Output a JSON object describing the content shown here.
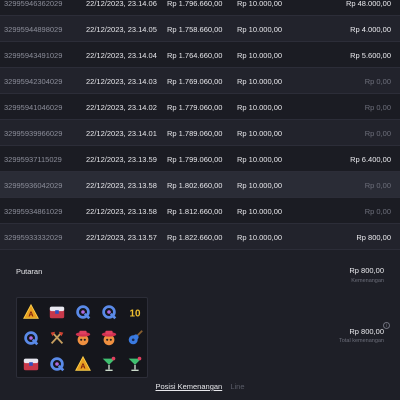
{
  "rows": [
    {
      "id": "32995946362029",
      "date": "22/12/2023, 23.14.06",
      "saldo": "Rp 1.796.660,00",
      "bet": "Rp 10.000,00",
      "win": "Rp 48.000,00",
      "zero": false
    },
    {
      "id": "32995944898029",
      "date": "22/12/2023, 23.14.05",
      "saldo": "Rp 1.758.660,00",
      "bet": "Rp 10.000,00",
      "win": "Rp 4.000,00",
      "zero": false
    },
    {
      "id": "32995943491029",
      "date": "22/12/2023, 23.14.04",
      "saldo": "Rp 1.764.660,00",
      "bet": "Rp 10.000,00",
      "win": "Rp 5.600,00",
      "zero": false
    },
    {
      "id": "32995942304029",
      "date": "22/12/2023, 23.14.03",
      "saldo": "Rp 1.769.060,00",
      "bet": "Rp 10.000,00",
      "win": "Rp 0,00",
      "zero": true
    },
    {
      "id": "32995941046029",
      "date": "22/12/2023, 23.14.02",
      "saldo": "Rp 1.779.060,00",
      "bet": "Rp 10.000,00",
      "win": "Rp 0,00",
      "zero": true
    },
    {
      "id": "32995939966029",
      "date": "22/12/2023, 23.14.01",
      "saldo": "Rp 1.789.060,00",
      "bet": "Rp 10.000,00",
      "win": "Rp 0,00",
      "zero": true
    },
    {
      "id": "32995937115029",
      "date": "22/12/2023, 23.13.59",
      "saldo": "Rp 1.799.060,00",
      "bet": "Rp 10.000,00",
      "win": "Rp 6.400,00",
      "zero": false
    },
    {
      "id": "32995936042029",
      "date": "22/12/2023, 23.13.58",
      "saldo": "Rp 1.802.660,00",
      "bet": "Rp 10.000,00",
      "win": "Rp 0,00",
      "zero": true
    },
    {
      "id": "32995934861029",
      "date": "22/12/2023, 23.13.58",
      "saldo": "Rp 1.812.660,00",
      "bet": "Rp 10.000,00",
      "win": "Rp 0,00",
      "zero": true
    },
    {
      "id": "32995933332029",
      "date": "22/12/2023, 23.13.57",
      "saldo": "Rp 1.822.660,00",
      "bet": "Rp 10.000,00",
      "win": "Rp 800,00",
      "zero": false
    }
  ],
  "detail": {
    "title": "Putaran",
    "total_amount": "Rp 800,00",
    "total_label": "Kemenangan",
    "spin_amount": "Rp 800,00",
    "spin_label": "Total kemenangan",
    "info_glyph": "i"
  },
  "reels": [
    [
      "triangle-a",
      "chest",
      "letter-q",
      "letter-q",
      "ten"
    ],
    [
      "letter-q",
      "axes",
      "chicken-hat",
      "chicken-hat",
      "guitar"
    ],
    [
      "chest",
      "letter-q",
      "triangle-a",
      "cocktail",
      "cocktail"
    ]
  ],
  "tabs": {
    "active": "Posisi Kemenangan",
    "inactive": "Line"
  },
  "colors": {
    "background": "#1e1f27",
    "row_border": "#2c2d38",
    "muted_text": "#6d6f7b"
  }
}
